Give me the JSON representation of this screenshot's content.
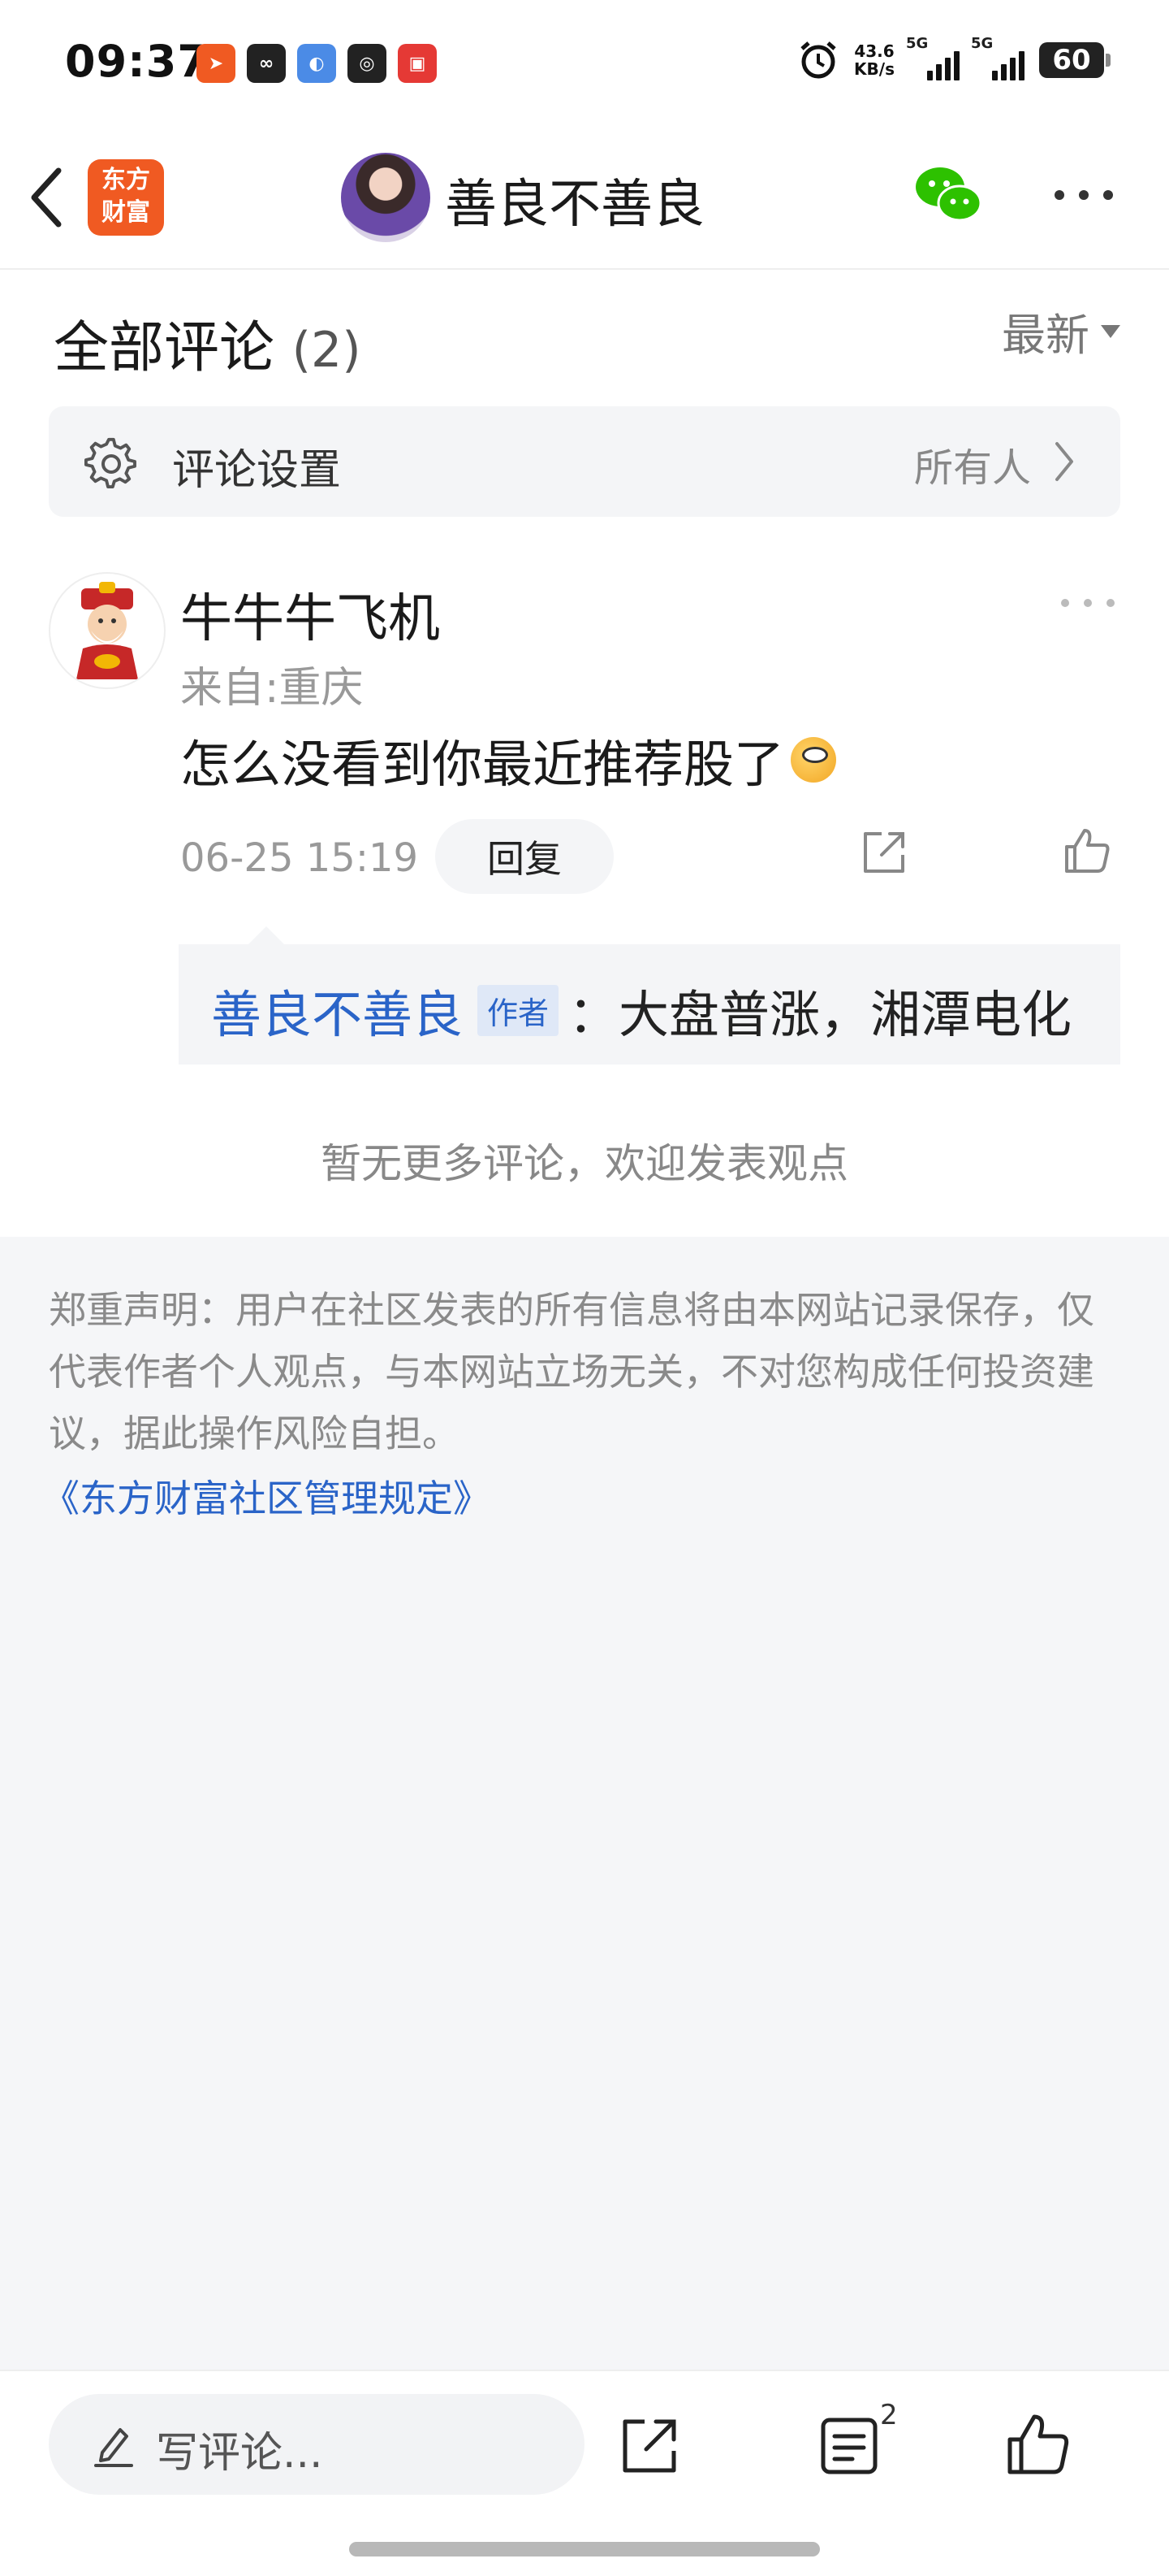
{
  "status_bar": {
    "time": "09:37",
    "net_speed_value": "43.6",
    "net_speed_unit": "KB/s",
    "signal1_label": "5G",
    "signal2_label": "5G",
    "battery": "60",
    "app_icons": [
      "app-icon-1",
      "app-icon-2",
      "app-icon-3",
      "app-icon-4",
      "app-icon-5"
    ]
  },
  "header": {
    "logo_line1": "东方",
    "logo_line2": "财富",
    "title": "善良不善良"
  },
  "comments": {
    "heading": "全部评论",
    "count": "(2)",
    "sort_label": "最新"
  },
  "settings": {
    "label": "评论设置",
    "value": "所有人"
  },
  "comment": {
    "user": "牛牛牛飞机",
    "location": "来自:重庆",
    "text": "怎么没看到你最近推荐股了",
    "time": "06-25 15:19",
    "reply_label": "回复",
    "reply": {
      "author": "善良不善良",
      "tag": "作者",
      "text": "：大盘普涨，湘潭电化"
    }
  },
  "no_more_text": "暂无更多评论，欢迎发表观点",
  "disclaimer": {
    "text": "郑重声明：用户在社区发表的所有信息将由本网站记录保存，仅代表作者个人观点，与本网站立场无关，不对您构成任何投资建议，据此操作风险自担。",
    "link": "《东方财富社区管理规定》"
  },
  "bottom_bar": {
    "comment_placeholder": "写评论...",
    "list_count": "2"
  },
  "colors": {
    "accent_blue": "#2a64c8",
    "brand_orange": "#f05a22"
  }
}
